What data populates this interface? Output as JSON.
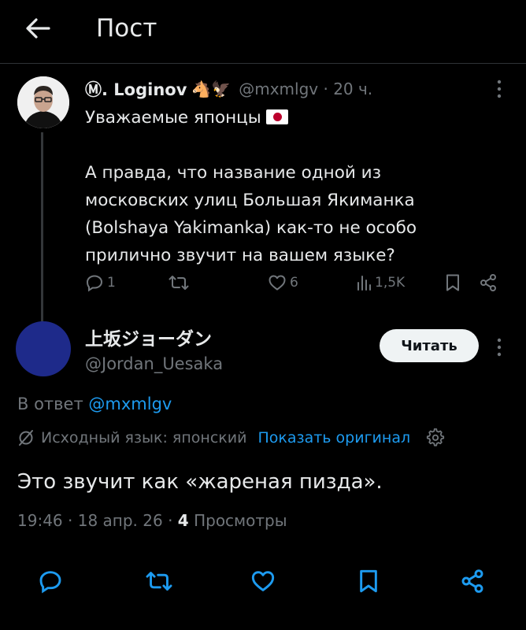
{
  "header": {
    "title": "Пост"
  },
  "parent_post": {
    "display_name": "Ⓜ. Loginov",
    "name_emojis": "🐴🦅",
    "handle": "@mxmlgv",
    "separator": "·",
    "time": "20 ч.",
    "greeting": "Уважаемые японцы",
    "body": "А правда, что название одной из\nмосковских улиц Большая Якиманка\n(Bolshaya Yakimanka) как-то не особо\nприлично звучит на вашем языке?",
    "stats": {
      "replies": "1",
      "likes": "6",
      "views": "1,5K"
    }
  },
  "reply": {
    "display_name": "上坂ジョーダン",
    "handle": "@Jordan_Uesaka",
    "follow_label": "Читать",
    "replying_prefix": "В ответ",
    "replying_to": "@mxmlgv",
    "translated_label": "Исходный язык: японский",
    "show_original": "Показать оригинал",
    "text": "Это звучит как «жареная пизда».",
    "time": "19:46",
    "date": "18 апр. 26",
    "dot": "·",
    "views_count": "4",
    "views_label": "Просмотры"
  },
  "colors": {
    "accent": "#1d9bf0",
    "muted": "#71767b",
    "text": "#e7e9ea",
    "background": "#000000"
  }
}
